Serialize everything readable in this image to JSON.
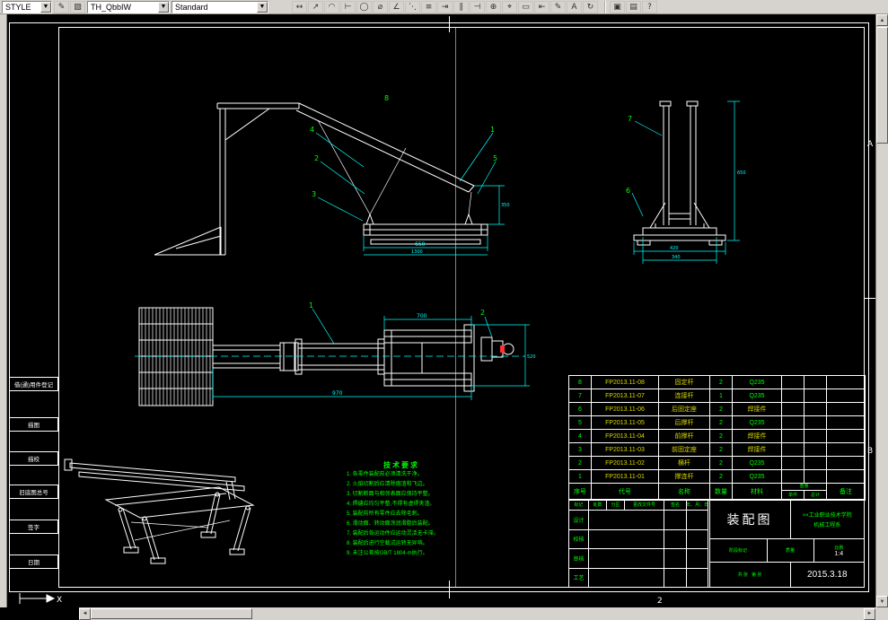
{
  "colors": {
    "canvas_bg": "#000000",
    "line": "#ffffff",
    "dimension": "#00ffff",
    "note_green": "#00ff00",
    "note_yellow": "#d8d800",
    "toolbar_bg": "#d6d3ce",
    "marker_red": "#ff3030"
  },
  "toolbar": {
    "style_combo": "STYLE",
    "dim_style_combo": "TH_QbbIW",
    "standard_combo": "Standard",
    "side_buttons": [
      {
        "name": "text-style-icon",
        "glyph": "✎"
      },
      {
        "name": "match-style-icon",
        "glyph": "▨"
      }
    ],
    "tools": [
      {
        "name": "linear-dimension-icon",
        "glyph": "↔"
      },
      {
        "name": "aligned-dimension-icon",
        "glyph": "↗"
      },
      {
        "name": "arc-length-dimension-icon",
        "glyph": "◠"
      },
      {
        "name": "ordinate-dimension-icon",
        "glyph": "⊢"
      },
      {
        "name": "radius-dimension-icon",
        "glyph": "◯"
      },
      {
        "name": "diameter-dimension-icon",
        "glyph": "⌀"
      },
      {
        "name": "angular-dimension-icon",
        "glyph": "∠"
      },
      {
        "name": "quick-dimension-icon",
        "glyph": "⋱"
      },
      {
        "name": "baseline-dimension-icon",
        "glyph": "≡"
      },
      {
        "name": "continue-dimension-icon",
        "glyph": "⇥"
      },
      {
        "name": "dimension-space-icon",
        "glyph": "∥"
      },
      {
        "name": "dimension-break-icon",
        "glyph": "⊣"
      },
      {
        "name": "tolerance-icon",
        "glyph": "⊕"
      },
      {
        "name": "center-mark-icon",
        "glyph": "⌖"
      },
      {
        "name": "inspection-icon",
        "glyph": "▭"
      },
      {
        "name": "jogged-linear-icon",
        "glyph": "⇤"
      },
      {
        "name": "dimension-edit-icon",
        "glyph": "✎"
      },
      {
        "name": "dimension-text-edit-icon",
        "glyph": "A"
      },
      {
        "name": "dimension-update-icon",
        "glyph": "↻"
      }
    ],
    "right_tools": [
      {
        "name": "dim-style-compare-icon",
        "glyph": "▣"
      },
      {
        "name": "dim-style-manager-icon",
        "glyph": "▤"
      },
      {
        "name": "help-icon",
        "glyph": "?"
      }
    ]
  },
  "sheet": {
    "zone_a": "A",
    "zone_b": "B",
    "zone_bottom": "2",
    "ucs_axis": "X",
    "margin_labels": [
      "借(通)用件登记",
      "描图",
      "描校",
      "旧底图总号",
      "签字",
      "日期"
    ]
  },
  "views": {
    "v1": {
      "balloons": [
        "8",
        "4",
        "1",
        "2",
        "5",
        "3"
      ],
      "dims": {
        "width": "650",
        "width2": "1300",
        "height": "350"
      }
    },
    "v2": {
      "balloons": [
        "7",
        "6"
      ],
      "dims": {
        "width": "420",
        "width2": "340",
        "height": "650"
      }
    },
    "v3": {
      "balloons": [
        "1",
        "2"
      ],
      "dims": {
        "top": "700",
        "bottom": "970",
        "right": "520"
      }
    }
  },
  "tech_req": {
    "title": "技术要求",
    "lines": [
      "1. 各零件装配前必须清洗干净。",
      "2. 火焰切割后应清除熔渣和飞边。",
      "3. 切割断面与相邻表面应保持平整。",
      "4. 焊缝应均匀平整,不得有虚焊夹渣。",
      "5. 装配前所有零件应去除毛刺。",
      "6. 滑动面、转动面涂润滑脂后装配。",
      "7. 装配后各运动件应运动灵活无卡滞。",
      "8. 装配后进行空载试运转无异响。",
      "9. 未注公差按GB/T 1804-m执行。"
    ]
  },
  "bom": {
    "headers": [
      "序号",
      "代号",
      "名称",
      "数量",
      "材料",
      "单件",
      "总计",
      "备注"
    ],
    "weight_label": "重量",
    "rows": [
      {
        "no": "8",
        "code": "FP2013.11-08",
        "name": "固定杆",
        "qty": "2",
        "material": "Q235",
        "material_color": "#00ff00"
      },
      {
        "no": "7",
        "code": "FP2013.11-07",
        "name": "连接杆",
        "qty": "1",
        "material": "Q235",
        "material_color": "#00ff00"
      },
      {
        "no": "6",
        "code": "FP2013.11-06",
        "name": "后固定座",
        "qty": "2",
        "material": "焊接件",
        "material_color": "#d8d800"
      },
      {
        "no": "5",
        "code": "FP2013.11-05",
        "name": "后撑杆",
        "qty": "2",
        "material": "Q235",
        "material_color": "#00ff00"
      },
      {
        "no": "4",
        "code": "FP2013.11-04",
        "name": "前撑杆",
        "qty": "2",
        "material": "焊接件",
        "material_color": "#d8d800"
      },
      {
        "no": "3",
        "code": "FP2013.11-03",
        "name": "前固定座",
        "qty": "2",
        "material": "焊接件",
        "material_color": "#d8d800"
      },
      {
        "no": "2",
        "code": "FP2013.11-02",
        "name": "横杆",
        "qty": "2",
        "material": "Q235",
        "material_color": "#00ff00"
      },
      {
        "no": "1",
        "code": "FP2013.11-01",
        "name": "撑连杆",
        "qty": "2",
        "material": "Q235",
        "material_color": "#00ff00"
      }
    ]
  },
  "title_block": {
    "drawing_title": "装配图",
    "org_line1": "××工业职业技术学院",
    "org_line2": "机械工程系",
    "date": "2015.3.18",
    "rev_headers": [
      "标记",
      "处数",
      "分区",
      "更改文件号",
      "签名",
      "年、月、日"
    ],
    "sign_labels": [
      "设计",
      "校核",
      "审核",
      "工艺"
    ],
    "stage_label": "阶段标记",
    "weight_label": "质量",
    "scale_label": "比例",
    "scale_value": "1:4",
    "sheet_count": "共 张",
    "sheet_no": "第 张"
  }
}
